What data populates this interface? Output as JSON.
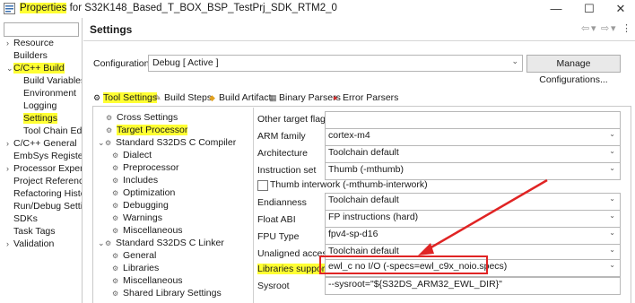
{
  "window": {
    "title_prefix": "Properties",
    "title_rest": " for S32K148_Based_T_BOX_BSP_TestPrj_SDK_RTM2_0",
    "minimize": "—",
    "maximize": "☐",
    "close": "✕"
  },
  "sidebar": {
    "items": [
      {
        "label": "Resource",
        "chevron": "›"
      },
      {
        "label": "Builders",
        "chevron": ""
      },
      {
        "label": "C/C++ Build",
        "chevron": "⌄"
      },
      {
        "label": "Build Variables",
        "chevron": ""
      },
      {
        "label": "Environment",
        "chevron": ""
      },
      {
        "label": "Logging",
        "chevron": ""
      },
      {
        "label": "Settings",
        "chevron": ""
      },
      {
        "label": "Tool Chain Edito",
        "chevron": ""
      },
      {
        "label": "C/C++ General",
        "chevron": "›"
      },
      {
        "label": "EmbSys Register V",
        "chevron": ""
      },
      {
        "label": "Processor Expert",
        "chevron": "›"
      },
      {
        "label": "Project References",
        "chevron": ""
      },
      {
        "label": "Refactoring Histor",
        "chevron": ""
      },
      {
        "label": "Run/Debug Settin",
        "chevron": ""
      },
      {
        "label": "SDKs",
        "chevron": ""
      },
      {
        "label": "Task Tags",
        "chevron": ""
      },
      {
        "label": "Validation",
        "chevron": "›"
      }
    ]
  },
  "header": {
    "title": "Settings"
  },
  "config": {
    "label": "Configuration:",
    "value": "Debug  [ Active ]",
    "manage_label": "Manage Configurations..."
  },
  "tabs": [
    {
      "label": "Tool Settings",
      "icon": "⚙"
    },
    {
      "label": "Build Steps",
      "icon": "✎"
    },
    {
      "label": "Build Artifact",
      "icon": "◆"
    },
    {
      "label": "Binary Parsers",
      "icon": "▦"
    },
    {
      "label": "Error Parsers",
      "icon": "●"
    }
  ],
  "tool_tree": [
    {
      "label": "Cross Settings"
    },
    {
      "label": "Target Processor"
    },
    {
      "label": "Standard S32DS C Compiler",
      "chevron": "⌄"
    },
    {
      "label": "Dialect"
    },
    {
      "label": "Preprocessor"
    },
    {
      "label": "Includes"
    },
    {
      "label": "Optimization"
    },
    {
      "label": "Debugging"
    },
    {
      "label": "Warnings"
    },
    {
      "label": "Miscellaneous"
    },
    {
      "label": "Standard S32DS C Linker",
      "chevron": "⌄"
    },
    {
      "label": "General"
    },
    {
      "label": "Libraries"
    },
    {
      "label": "Miscellaneous"
    },
    {
      "label": "Shared Library Settings"
    }
  ],
  "props": {
    "other_flags": {
      "label": "Other target flags",
      "value": ""
    },
    "arm_family": {
      "label": "ARM family",
      "value": "cortex-m4"
    },
    "architecture": {
      "label": "Architecture",
      "value": "Toolchain default"
    },
    "instruction_set": {
      "label": "Instruction set",
      "value": "Thumb (-mthumb)"
    },
    "thumb_interwork": {
      "label": "Thumb interwork (-mthumb-interwork)"
    },
    "endianness": {
      "label": "Endianness",
      "value": "Toolchain default"
    },
    "float_abi": {
      "label": "Float ABI",
      "value": "FP instructions (hard)"
    },
    "fpu_type": {
      "label": "FPU Type",
      "value": "fpv4-sp-d16"
    },
    "unaligned": {
      "label": "Unaligned access",
      "value": "Toolchain default"
    },
    "libraries": {
      "label": "Libraries suppor",
      "value": "ewl_c no I/O (-specs=ewl_c9x_noio.specs)"
    },
    "sysroot": {
      "label": "Sysroot",
      "value": "--sysroot=\"${S32DS_ARM32_EWL_DIR}\""
    }
  },
  "colors": {
    "highlight": "#ffff33",
    "annotation_red": "#e02424"
  }
}
